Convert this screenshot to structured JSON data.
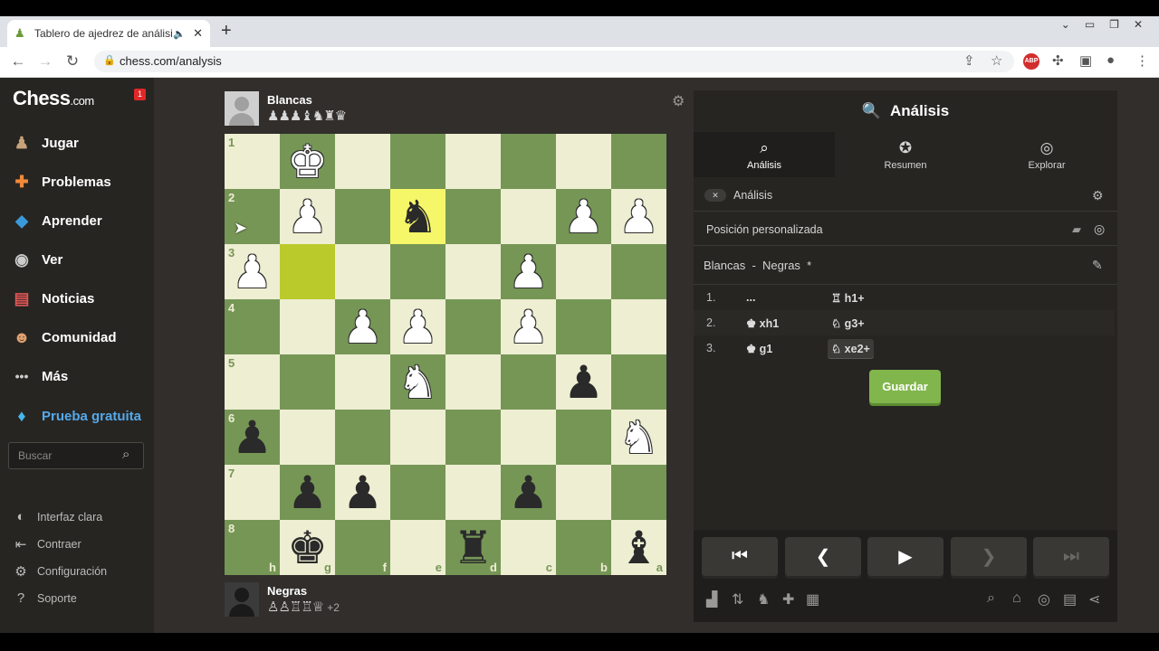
{
  "browser": {
    "tab_title": "Tablero de ajedrez de análisis",
    "url": "chess.com/analysis",
    "new_tab": "+",
    "tab_close": "✕"
  },
  "sidebar": {
    "logo": "Chess",
    "logo_suffix": ".com",
    "notification_count": "1",
    "items": [
      {
        "label": "Jugar",
        "icon": "pawn-icon"
      },
      {
        "label": "Problemas",
        "icon": "puzzle-icon"
      },
      {
        "label": "Aprender",
        "icon": "cube-icon"
      },
      {
        "label": "Ver",
        "icon": "binoculars-icon"
      },
      {
        "label": "Noticias",
        "icon": "newspaper-icon"
      },
      {
        "label": "Comunidad",
        "icon": "people-icon"
      },
      {
        "label": "Más",
        "icon": "dots-icon"
      },
      {
        "label": "Prueba gratuita",
        "icon": "diamond-icon"
      }
    ],
    "search_placeholder": "Buscar",
    "footer": [
      {
        "label": "Interfaz clara"
      },
      {
        "label": "Contraer"
      },
      {
        "label": "Configuración"
      },
      {
        "label": "Soporte"
      }
    ]
  },
  "players": {
    "top": {
      "name": "Blancas",
      "captured": "♟♟♟♝♞♜♛"
    },
    "bottom": {
      "name": "Negras",
      "captured": "♙♙♖♖♕",
      "advantage": "+2"
    }
  },
  "board": {
    "orientation": "black-bottom",
    "ranks": [
      "1",
      "2",
      "3",
      "4",
      "5",
      "6",
      "7",
      "8"
    ],
    "files": [
      "h",
      "g",
      "f",
      "e",
      "d",
      "c",
      "b",
      "a"
    ],
    "rows": [
      [
        "",
        "wK",
        "",
        "",
        "",
        "",
        "",
        ""
      ],
      [
        "",
        "wP",
        "",
        "bN",
        "",
        "",
        "wP",
        "wP"
      ],
      [
        "wP",
        "",
        "",
        "",
        "",
        "wP",
        "",
        ""
      ],
      [
        "",
        "",
        "wP",
        "wP",
        "",
        "wP",
        "",
        ""
      ],
      [
        "",
        "",
        "",
        "wN",
        "",
        "",
        "bP",
        ""
      ],
      [
        "bP",
        "",
        "",
        "",
        "",
        "",
        "",
        "wN"
      ],
      [
        "",
        "bP",
        "bP",
        "",
        "",
        "bP",
        "",
        ""
      ],
      [
        "",
        "bK",
        "",
        "",
        "bR",
        "",
        "",
        "bB"
      ]
    ],
    "highlights": [
      [
        1,
        3
      ],
      [
        2,
        1
      ]
    ]
  },
  "panel": {
    "title": "Análisis",
    "tabs": [
      {
        "label": "Análisis",
        "icon": "magnifier-icon"
      },
      {
        "label": "Resumen",
        "icon": "star-icon"
      },
      {
        "label": "Explorar",
        "icon": "compass-icon"
      }
    ],
    "engine_toggle_label": "Análisis",
    "position_label": "Posición personalizada",
    "players_line": "Blancas  -  Negras  *",
    "moves": [
      {
        "num": "1.",
        "white": "...",
        "black": "♖ h1+"
      },
      {
        "num": "2.",
        "white": "♚ xh1",
        "black": "♘ g3+"
      },
      {
        "num": "3.",
        "white": "♚ g1",
        "black": "♘ xe2+"
      }
    ],
    "save_label": "Guardar",
    "controls": [
      "⏮",
      "❮",
      "▶",
      "❯",
      "⏭"
    ]
  }
}
